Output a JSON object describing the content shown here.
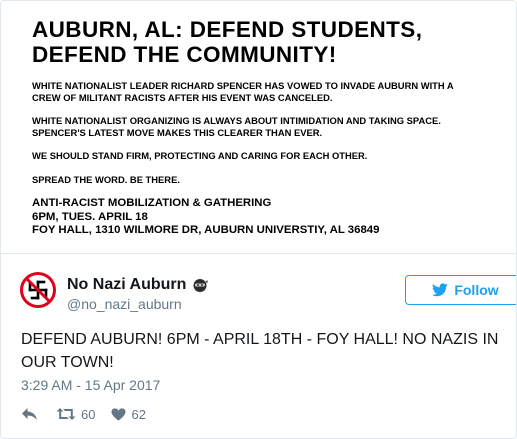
{
  "flyer": {
    "title_lines": [
      "AUBURN, AL: DEFEND STUDENTS,",
      "DEFEND THE COMMUNITY!"
    ],
    "paragraph1_lines": [
      "WHITE NATIONALIST LEADER RICHARD SPENCER HAS VOWED TO INVADE AUBURN WITH A",
      "CREW OF MILITANT RACISTS AFTER HIS EVENT WAS CANCELED."
    ],
    "paragraph2_lines": [
      "WHITE NATIONALIST ORGANIZING IS ALWAYS ABOUT INTIMIDATION AND TAKING SPACE.",
      "SPENCER'S LATEST MOVE MAKES THIS CLEARER THAN EVER."
    ],
    "paragraph3": "WE SHOULD STAND FIRM, PROTECTING AND CARING FOR EACH OTHER.",
    "paragraph4": "SPREAD THE WORD. BE THERE.",
    "event_lines": [
      "ANTI-RACIST MOBILIZATION & GATHERING",
      "6PM, TUES. APRIL 18",
      "FOY HALL, 1310 WILMORE DR, AUBURN UNIVERSTIY, AL 36849"
    ]
  },
  "author": {
    "display_name": "No Nazi Auburn",
    "handle": "@no_nazi_auburn",
    "name_emoji": "ninja-icon",
    "avatar_icon": "no-swastika-icon"
  },
  "follow_button": {
    "label": "Follow",
    "icon": "twitter-bird-icon"
  },
  "tweet": {
    "text_lines": [
      "DEFEND AUBURN! 6PM - APRIL 18TH - FOY HALL! NO NAZIS IN",
      "OUR TOWN!"
    ],
    "timestamp": "3:29 AM - 15 Apr 2017"
  },
  "actions": {
    "reply_icon": "reply-icon",
    "retweet_icon": "retweet-icon",
    "retweet_count": "60",
    "like_icon": "heart-icon",
    "like_count": "62"
  },
  "colors": {
    "accent": "#1da1f2",
    "text": "#14171a",
    "muted": "#657786",
    "avatar_red": "#e0001b",
    "border": "#e1e8ed"
  }
}
